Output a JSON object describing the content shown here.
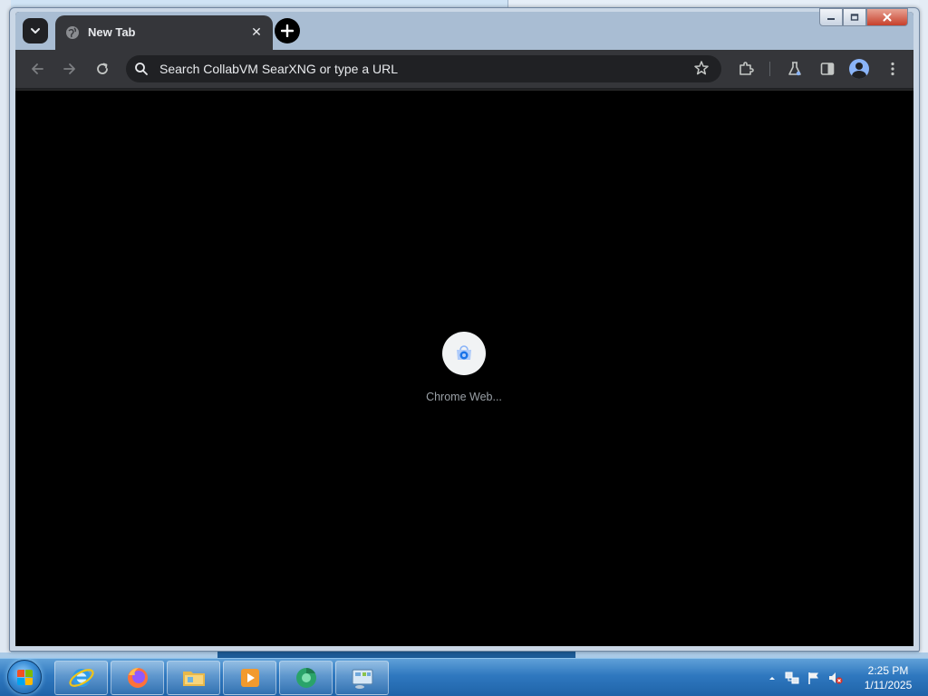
{
  "browser": {
    "tab_search_icon": "chevron-down-icon",
    "tab": {
      "title": "New Tab",
      "favicon": "globe-icon",
      "close_icon": "close-icon"
    },
    "new_tab_icon": "plus-icon",
    "window_controls": {
      "minimize": "minimize-icon",
      "maximize": "maximize-icon",
      "close": "close-icon"
    },
    "toolbar": {
      "back_icon": "arrow-left-icon",
      "forward_icon": "arrow-right-icon",
      "reload_icon": "reload-icon",
      "omnibox_placeholder": "Search CollabVM SearXNG or type a URL",
      "bookmark_icon": "star-icon",
      "extensions_icon": "puzzle-icon",
      "labs_icon": "flask-icon",
      "side_panel_icon": "side-panel-icon",
      "profile_icon": "avatar-icon",
      "menu_icon": "kebab-menu-icon"
    },
    "content": {
      "shortcuts": [
        {
          "label": "Chrome Web...",
          "icon": "chrome-web-store-icon"
        }
      ]
    }
  },
  "taskbar": {
    "start_icon": "windows-start-icon",
    "apps": [
      {
        "name": "Internet Explorer",
        "icon": "internet-explorer-icon"
      },
      {
        "name": "Firefox",
        "icon": "firefox-icon"
      },
      {
        "name": "Windows Explorer",
        "icon": "folder-icon"
      },
      {
        "name": "Media Player",
        "icon": "media-player-icon"
      },
      {
        "name": "Chrome",
        "icon": "chrome-icon"
      },
      {
        "name": "Control Panel",
        "icon": "control-panel-icon"
      }
    ],
    "tray": {
      "show_hidden_icon": "chevron-up-icon",
      "network_icon": "network-icon",
      "action_center_icon": "flag-icon",
      "volume_icon": "speaker-muted-icon",
      "time": "2:25 PM",
      "date": "1/11/2025"
    }
  },
  "colors": {
    "tab_active": "#35363a",
    "toolbar": "#35363a",
    "omnibox": "#202124",
    "content_bg": "#000000",
    "taskbar": "#2f78bf"
  }
}
